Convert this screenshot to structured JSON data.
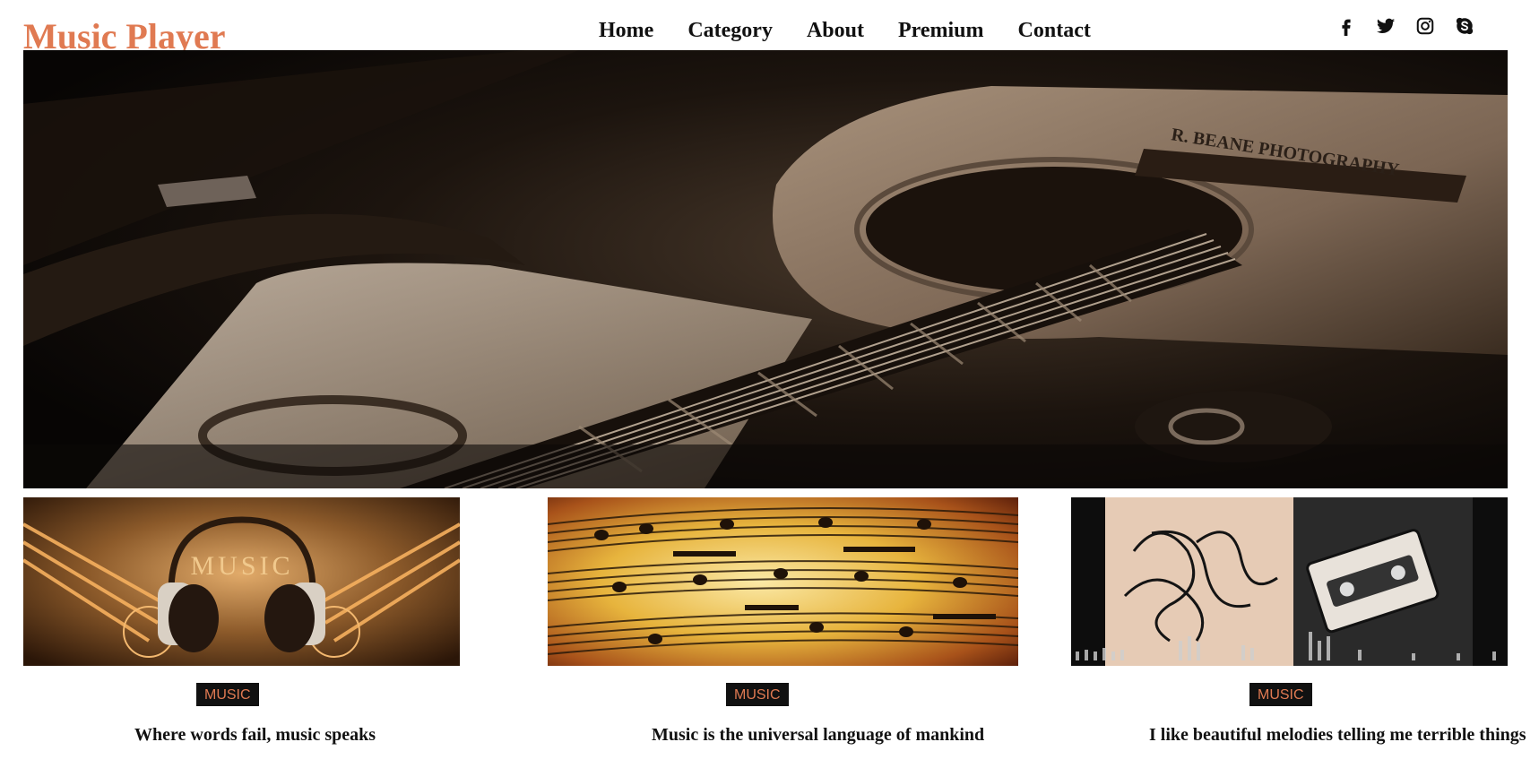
{
  "header": {
    "logo": "Music Player",
    "nav": [
      "Home",
      "Category",
      "About",
      "Premium",
      "Contact"
    ],
    "social_icons": [
      "facebook-icon",
      "twitter-icon",
      "instagram-icon",
      "skype-icon"
    ]
  },
  "hero": {
    "image": "acoustic-guitar-photo",
    "watermark": "R. BEANE PHOTOGRAPHY"
  },
  "cards": [
    {
      "image": "headphones-music-image",
      "image_text": "MUSIC",
      "badge": "MUSIC",
      "quote": "Where words fail, music speaks"
    },
    {
      "image": "sheet-music-image",
      "badge": "MUSIC",
      "quote": "Music is the universal language of mankind"
    },
    {
      "image": "cassette-tape-image",
      "badge": "MUSIC",
      "quote": "I like beautiful melodies telling me terrible things"
    }
  ],
  "colors": {
    "accent": "#e07a52",
    "text": "#111111",
    "badge_bg": "#111111"
  }
}
